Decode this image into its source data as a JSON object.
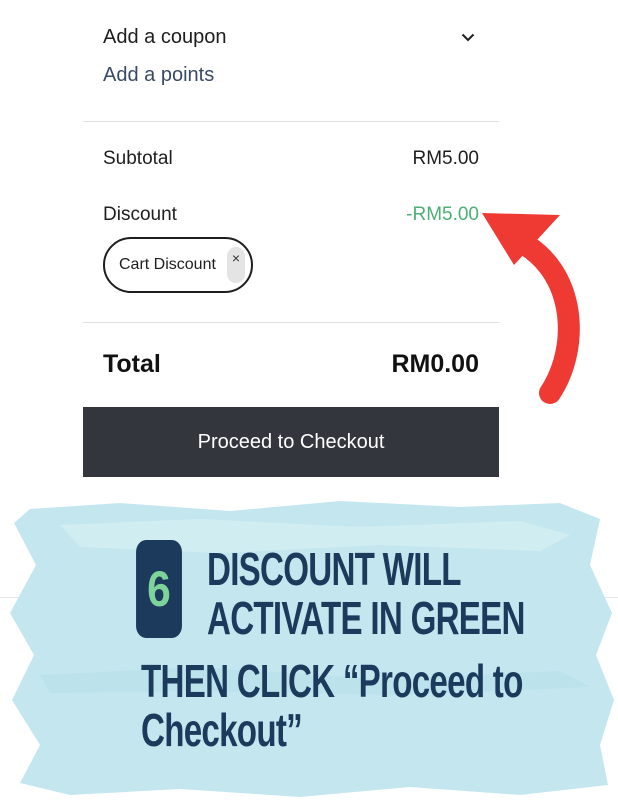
{
  "coupon": {
    "label": "Add a coupon",
    "points_link": "Add a points"
  },
  "summary": {
    "subtotal_label": "Subtotal",
    "subtotal_value": "RM5.00",
    "discount_label": "Discount",
    "discount_value": "-RM5.00",
    "discount_chip": "Cart Discount",
    "chip_remove": "×",
    "total_label": "Total",
    "total_value": "RM0.00"
  },
  "checkout": {
    "button_label": "Proceed to Checkout"
  },
  "caption": {
    "step_number": "6",
    "line1": "DISCOUNT WILL",
    "line2": "ACTIVATE IN GREEN",
    "line3": "THEN CLICK “Proceed to",
    "line4": "Checkout”"
  },
  "colors": {
    "discount_green": "#4caf74",
    "button_dark": "#33373d",
    "arrow_red": "#ef3a33",
    "caption_navy": "#1c3a5c",
    "brush_blue": "#c4e7ef"
  },
  "icons": {
    "chevron": "chevron-down-icon",
    "arrow": "curved-arrow-icon"
  }
}
